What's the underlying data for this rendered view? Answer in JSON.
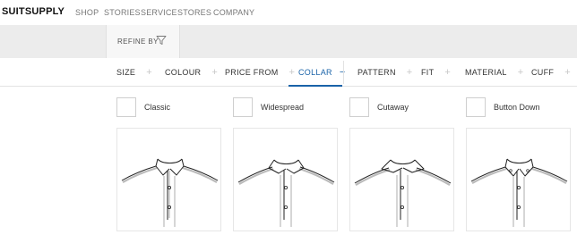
{
  "brand": "SUITSUPPLY",
  "nav": [
    "SHOP",
    "STORIES",
    "SERVICE",
    "STORES",
    "COMPANY"
  ],
  "refine": {
    "label": "REFINE BY"
  },
  "filters": [
    {
      "label": "SIZE",
      "symbol": "+",
      "active": false
    },
    {
      "label": "COLOUR",
      "symbol": "+",
      "active": false
    },
    {
      "label": "PRICE FROM",
      "symbol": "+",
      "active": false
    },
    {
      "label": "COLLAR",
      "symbol": "−",
      "active": true
    },
    {
      "label": "PATTERN",
      "symbol": "+",
      "active": false
    },
    {
      "label": "FIT",
      "symbol": "+",
      "active": false
    },
    {
      "label": "MATERIAL",
      "symbol": "+",
      "active": false
    },
    {
      "label": "CUFF",
      "symbol": "+",
      "active": false
    }
  ],
  "collar_options": [
    {
      "label": "Classic",
      "checked": false,
      "icon": "classic-collar-icon"
    },
    {
      "label": "Widespread",
      "checked": false,
      "icon": "widespread-collar-icon"
    },
    {
      "label": "Cutaway",
      "checked": false,
      "icon": "cutaway-collar-icon"
    },
    {
      "label": "Button Down",
      "checked": false,
      "icon": "button-down-collar-icon"
    }
  ],
  "colors": {
    "active": "#1a63a8",
    "band": "#ececec"
  }
}
